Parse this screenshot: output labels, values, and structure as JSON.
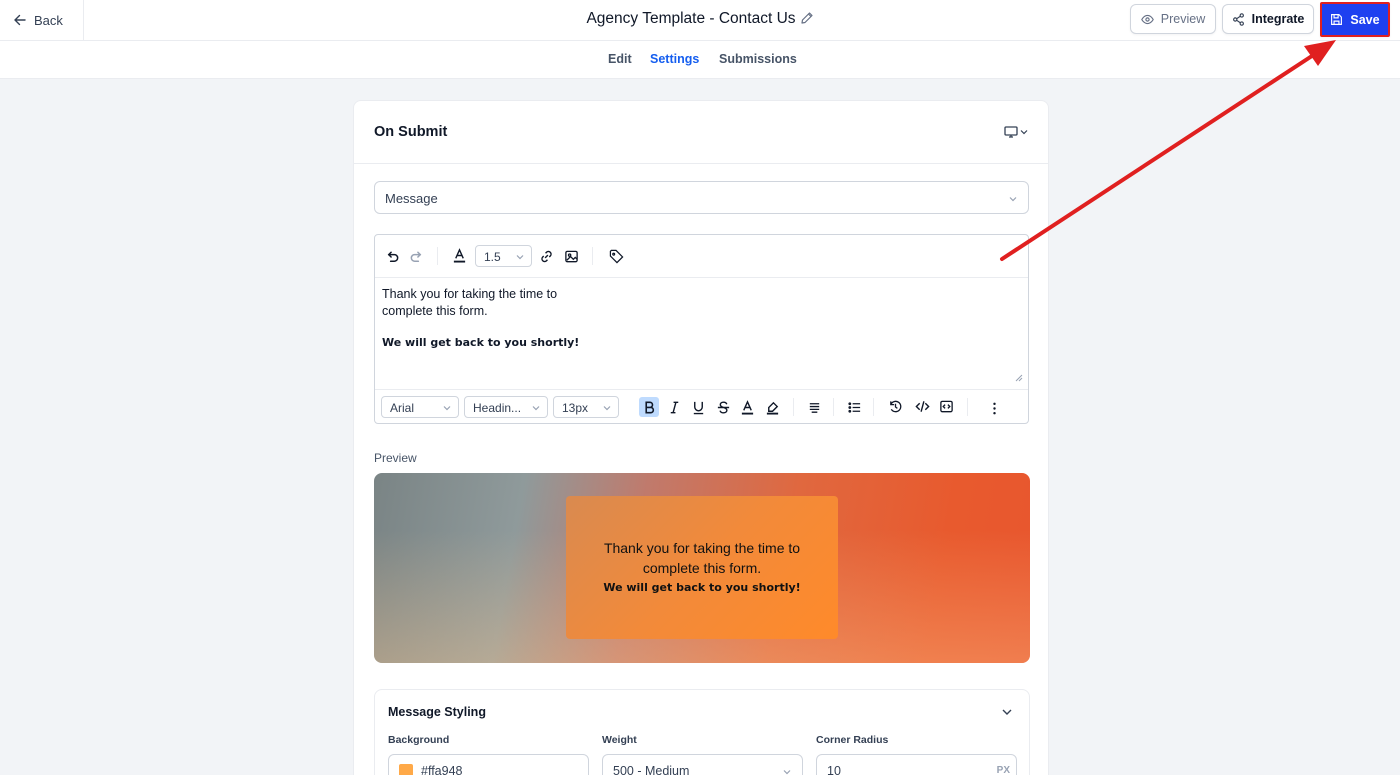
{
  "header": {
    "back_label": "Back",
    "title": "Agency Template - Contact Us",
    "preview_label": "Preview",
    "integrate_label": "Integrate",
    "save_label": "Save"
  },
  "tabs": [
    {
      "label": "Edit",
      "active": false
    },
    {
      "label": "Settings",
      "active": true
    },
    {
      "label": "Submissions",
      "active": false
    }
  ],
  "card": {
    "title": "On Submit",
    "action_select": "Message"
  },
  "editor": {
    "line_height": "1.5",
    "text_line1": "Thank you for taking the time to",
    "text_line2": "complete this form.",
    "text_bold": "We will get back to you shortly!",
    "font_family": "Arial",
    "block_type": "Headin...",
    "font_size": "13px"
  },
  "preview": {
    "label": "Preview",
    "line1": "Thank you for taking the time to",
    "line2": "complete this form.",
    "bold": "We will get back to you shortly!"
  },
  "styling": {
    "title": "Message Styling",
    "background_label": "Background",
    "background_value": "#ffa948",
    "weight_label": "Weight",
    "weight_value": "500 - Medium",
    "radius_label": "Corner Radius",
    "radius_value": "10",
    "radius_unit": "PX"
  },
  "colors": {
    "accent": "#155eef",
    "save_bg": "#1e40f0",
    "annotation": "#e02020",
    "message_bg": "#ffa948"
  }
}
